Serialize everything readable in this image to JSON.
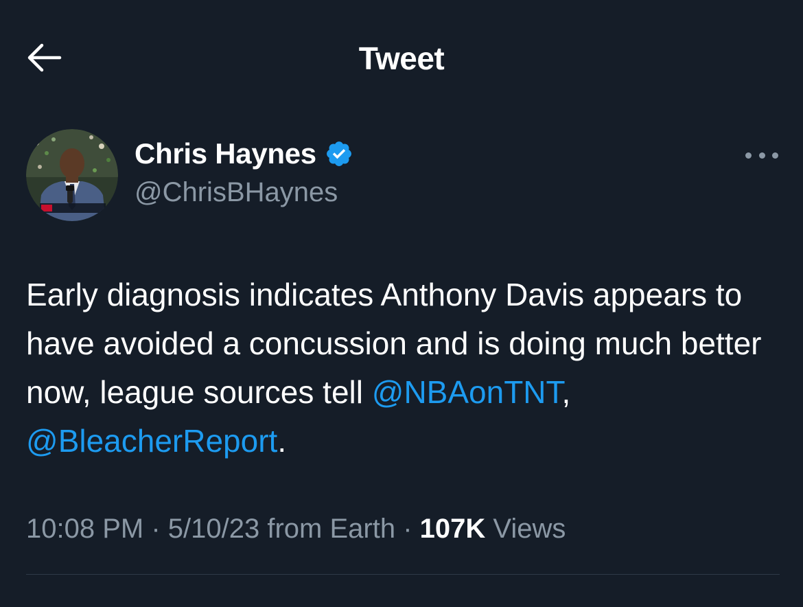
{
  "header": {
    "back_icon": "arrow-left-icon",
    "title": "Tweet"
  },
  "author": {
    "display_name": "Chris Haynes",
    "verified": true,
    "verified_icon": "verified-badge-icon",
    "verified_color": "#1d9bf0",
    "handle": "@ChrisBHaynes",
    "avatar_icon": "avatar-photo"
  },
  "more_icon": "more-horizontal-icon",
  "tweet": {
    "text_parts": [
      "Early diagnosis indicates Anthony Davis appears to have avoided a concussion and is doing much better now, league sources tell ",
      ", ",
      "."
    ],
    "mentions": [
      "@NBAonTNT",
      "@BleacherReport"
    ]
  },
  "meta": {
    "time": "10:08 PM",
    "separator": " · ",
    "date": "5/10/23",
    "source": " from Earth",
    "views_count": "107K",
    "views_label": " Views"
  },
  "colors": {
    "background": "#151d28",
    "text": "#ffffff",
    "secondary": "#8b98a5",
    "link": "#1d9bf0",
    "divider": "#2f3a47"
  }
}
